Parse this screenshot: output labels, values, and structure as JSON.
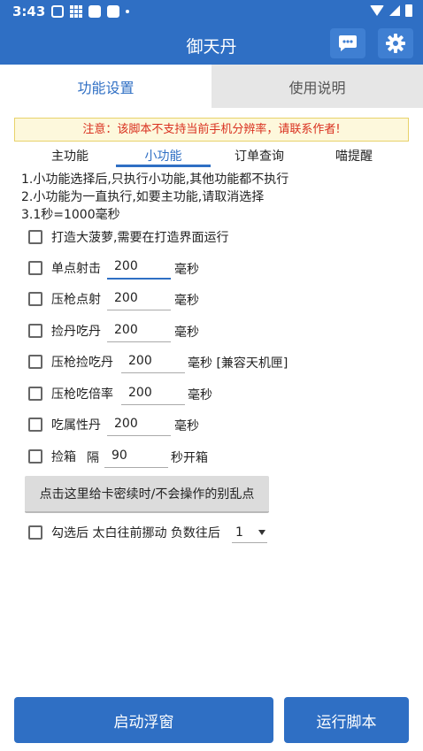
{
  "status": {
    "time": "3:43"
  },
  "app": {
    "title": "御天丹"
  },
  "tabs": [
    {
      "label": "功能设置",
      "active": true
    },
    {
      "label": "使用说明",
      "active": false
    }
  ],
  "warning": "注意：该脚本不支持当前手机分辨率，请联系作者!",
  "subtabs": [
    {
      "label": "主功能"
    },
    {
      "label": "小功能",
      "active": true
    },
    {
      "label": "订单查询"
    },
    {
      "label": "喵提醒"
    }
  ],
  "info": [
    "1.小功能选择后,只执行小功能,其他功能都不执行",
    "2.小功能为一直执行,如要主功能,请取消选择",
    "3.1秒=1000毫秒"
  ],
  "options": {
    "pineapple": {
      "label": "打造大菠萝,需要在打造界面运行"
    },
    "single_shot": {
      "label": "单点射击",
      "value": "200",
      "unit": "毫秒"
    },
    "press_shot": {
      "label": "压枪点射",
      "value": "200",
      "unit": "毫秒"
    },
    "pick_pill": {
      "label": "捡丹吃丹",
      "value": "200",
      "unit": "毫秒"
    },
    "press_pick_pill": {
      "label": "压枪捡吃丹",
      "value": "200",
      "unit": "毫秒 [兼容天机匣]"
    },
    "press_multiplier": {
      "label": "压枪吃倍率",
      "value": "200",
      "unit": "毫秒"
    },
    "attr_pill": {
      "label": "吃属性丹",
      "value": "200",
      "unit": "毫秒"
    },
    "pick_box": {
      "label": "捡箱",
      "sep": "隔",
      "value": "90",
      "unit": "秒开箱"
    },
    "taibai": {
      "label": "勾选后 太白往前挪动 负数往后",
      "selected": "1"
    }
  },
  "card_button": "点击这里给卡密续时/不会操作的别乱点",
  "bottom": {
    "float_button": "启动浮窗",
    "run_button": "运行脚本"
  },
  "colors": {
    "primary": "#2f6fc4",
    "warning_text": "#d9301f",
    "warning_bg": "#fdf8dc"
  }
}
